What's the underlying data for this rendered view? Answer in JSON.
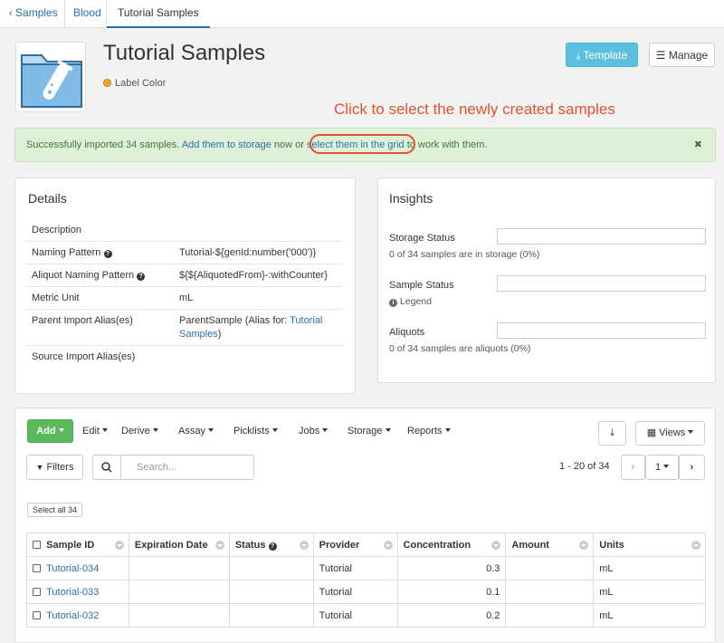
{
  "breadcrumb": {
    "back": "Samples",
    "parent": "Blood",
    "current": "Tutorial Samples"
  },
  "header": {
    "title": "Tutorial Samples",
    "label_color": "Label Color",
    "label_color_hex": "#f0a32a",
    "template_button": "Template",
    "manage_button": "Manage"
  },
  "callout": "Click to select the newly created samples",
  "alert": {
    "prefix": "Successfully imported 34 samples. ",
    "storage_link": "Add them to storage",
    "middle": " now or ",
    "grid_link": "select them in the grid",
    "suffix": " to work with them."
  },
  "details": {
    "title": "Details",
    "rows": [
      {
        "label": "Description",
        "value": ""
      },
      {
        "label": "Naming Pattern",
        "value": "Tutorial-${genId:number('000')}"
      },
      {
        "label": "Aliquot Naming Pattern",
        "value": "${${AliquotedFrom}-:withCounter}"
      },
      {
        "label": "Metric Unit",
        "value": "mL"
      },
      {
        "label": "Parent Import Alias(es)",
        "value": "ParentSample (Alias for: ",
        "link": "Tutorial Samples",
        "value_suffix": ")"
      },
      {
        "label": "Source Import Alias(es)",
        "value": ""
      }
    ]
  },
  "insights": {
    "title": "Insights",
    "storage_label": "Storage Status",
    "storage_sub": "0 of 34 samples are in storage (0%)",
    "status_label": "Sample Status",
    "legend": "Legend",
    "aliquots_label": "Aliquots",
    "aliquots_sub": "0 of 34 samples are aliquots (0%)",
    "storage_fraction": 0,
    "aliquot_fraction": 0
  },
  "toolbar": {
    "add": "Add",
    "menus": [
      "Edit",
      "Derive",
      "Assay",
      "Picklists",
      "Jobs",
      "Storage",
      "Reports"
    ],
    "views": "Views",
    "filters": "Filters",
    "search_placeholder": "Search...",
    "paging": "1 - 20 of 34",
    "page": "1",
    "select_all": "Select all 34"
  },
  "grid": {
    "columns": [
      "Sample ID",
      "Expiration Date",
      "Status",
      "Provider",
      "Concentration",
      "Amount",
      "Units"
    ],
    "rows": [
      {
        "id": "Tutorial-034",
        "expiration": "",
        "status": "",
        "provider": "Tutorial",
        "concentration": "0.3",
        "amount": "",
        "units": "mL"
      },
      {
        "id": "Tutorial-033",
        "expiration": "",
        "status": "",
        "provider": "Tutorial",
        "concentration": "0.1",
        "amount": "",
        "units": "mL"
      },
      {
        "id": "Tutorial-032",
        "expiration": "",
        "status": "",
        "provider": "Tutorial",
        "concentration": "0.2",
        "amount": "",
        "units": "mL"
      }
    ]
  }
}
